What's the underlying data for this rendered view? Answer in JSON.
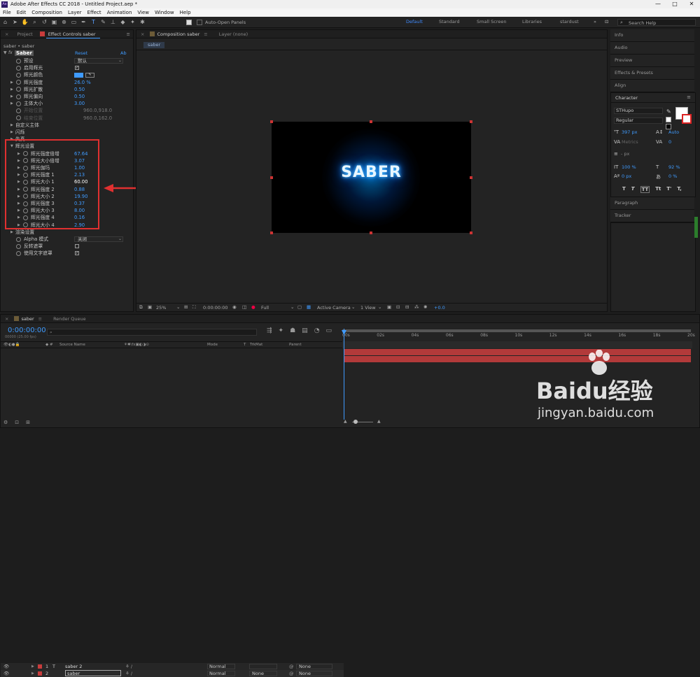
{
  "app": {
    "title": "Adobe After Effects CC 2018 - Untitled Project.aep *"
  },
  "menu": [
    "File",
    "Edit",
    "Composition",
    "Layer",
    "Effect",
    "Animation",
    "View",
    "Window",
    "Help"
  ],
  "toolbar": {
    "auto_open": "Auto-Open Panels"
  },
  "workspaces": [
    "Default",
    "Standard",
    "Small Screen",
    "Libraries",
    "stardust"
  ],
  "search_help": "Search Help",
  "left_panel": {
    "tabs": [
      "Project",
      "Effect Controls saber"
    ],
    "breadcrumb": "saber • saber",
    "effect_name": "Saber",
    "reset": "Reset",
    "about": "Ab",
    "rows": [
      {
        "label": "预设",
        "value": "默认",
        "kind": "dropdown"
      },
      {
        "label": "启用辉光",
        "value": "✓",
        "kind": "check"
      },
      {
        "label": "辉光颜色",
        "value": "",
        "kind": "color"
      },
      {
        "label": "辉光强度",
        "value": "26.0 %"
      },
      {
        "label": "辉光扩散",
        "value": "0.50"
      },
      {
        "label": "辉光偏向",
        "value": "0.50"
      },
      {
        "label": "主体大小",
        "value": "3.00"
      },
      {
        "label": "开始位置",
        "value": "960.0,918.0",
        "kind": "disabled"
      },
      {
        "label": "结束位置",
        "value": "960.0,162.0",
        "kind": "disabled"
      },
      {
        "label": "自定义主体",
        "value": ""
      },
      {
        "label": "闪烁",
        "value": ""
      },
      {
        "label": "失真",
        "value": ""
      },
      {
        "label": "辉光设置",
        "value": ""
      },
      {
        "label": "辉光强度倍增",
        "value": "67.64"
      },
      {
        "label": "辉光大小倍增",
        "value": "3.07"
      },
      {
        "label": "辉光伽玛",
        "value": "1.00"
      },
      {
        "label": "辉光强度 1",
        "value": "2.13"
      },
      {
        "label": "辉光大小 1",
        "value": "60.00",
        "kind": "white"
      },
      {
        "label": "辉光强度 2",
        "value": "0.88"
      },
      {
        "label": "辉光大小 2",
        "value": "19.90"
      },
      {
        "label": "辉光强度 3",
        "value": "0.37"
      },
      {
        "label": "辉光大小 3",
        "value": "8.00"
      },
      {
        "label": "辉光强度 4",
        "value": "0.16"
      },
      {
        "label": "辉光大小 4",
        "value": "2.90"
      },
      {
        "label": "渲染设置",
        "value": ""
      },
      {
        "label": "Alpha 模式",
        "value": "关闭",
        "kind": "dropdown"
      },
      {
        "label": "反转遮罩",
        "value": "",
        "kind": "check"
      },
      {
        "label": "使用文字遮罩",
        "value": "✓",
        "kind": "check"
      }
    ]
  },
  "center": {
    "tabs": [
      "Composition saber",
      "Layer (none)"
    ],
    "subtab": "saber",
    "comp_text": "SABER",
    "footer": {
      "zoom": "25%",
      "time": "0:00:00:00",
      "resolution": "Full",
      "camera": "Active Camera",
      "view": "1 View",
      "exposure": "+0.0"
    }
  },
  "right_panel": {
    "items": [
      "Info",
      "Audio",
      "Preview",
      "Effects & Presets",
      "Align"
    ],
    "character": {
      "title": "Character",
      "font": "STHupo",
      "style": "Regular",
      "size": "397 px",
      "leading": "Auto",
      "kerning": "Metrics",
      "tracking": "0",
      "stroke": "- px",
      "vscale": "100 %",
      "hscale": "92 %",
      "baseline": "0 px",
      "tsume": "0 %",
      "styles": [
        "T",
        "T",
        "TT",
        "Tt",
        "T'",
        "T,"
      ]
    },
    "bottom_items": [
      "Paragraph",
      "Tracker"
    ]
  },
  "timeline": {
    "tabs": [
      "saber",
      "Render Queue"
    ],
    "timecode": "0:00:00:00",
    "fps": "00000 (25.00 fps)",
    "headers": {
      "source": "Source Name",
      "mode": "Mode",
      "t": "T",
      "trkmat": "TrkMat",
      "parent": "Parent"
    },
    "layers": [
      {
        "num": "1",
        "type": "T",
        "name": "saber 2",
        "mode": "Normal",
        "trkmat": "",
        "parent": "None",
        "color": "#c83c3c"
      },
      {
        "num": "2",
        "type": "",
        "name": "saber",
        "mode": "Normal",
        "trkmat": "None",
        "parent": "None",
        "color": "#c83c3c"
      }
    ],
    "ruler": [
      "00s",
      "02s",
      "04s",
      "06s",
      "08s",
      "10s",
      "12s",
      "14s",
      "16s",
      "18s",
      "20s"
    ]
  },
  "watermark": {
    "brand": "Baidu经验",
    "url": "jingyan.baidu.com"
  },
  "colors": {
    "accent": "#3f9bff",
    "highlight_box": "#e03030",
    "track": "#b23a3a"
  }
}
